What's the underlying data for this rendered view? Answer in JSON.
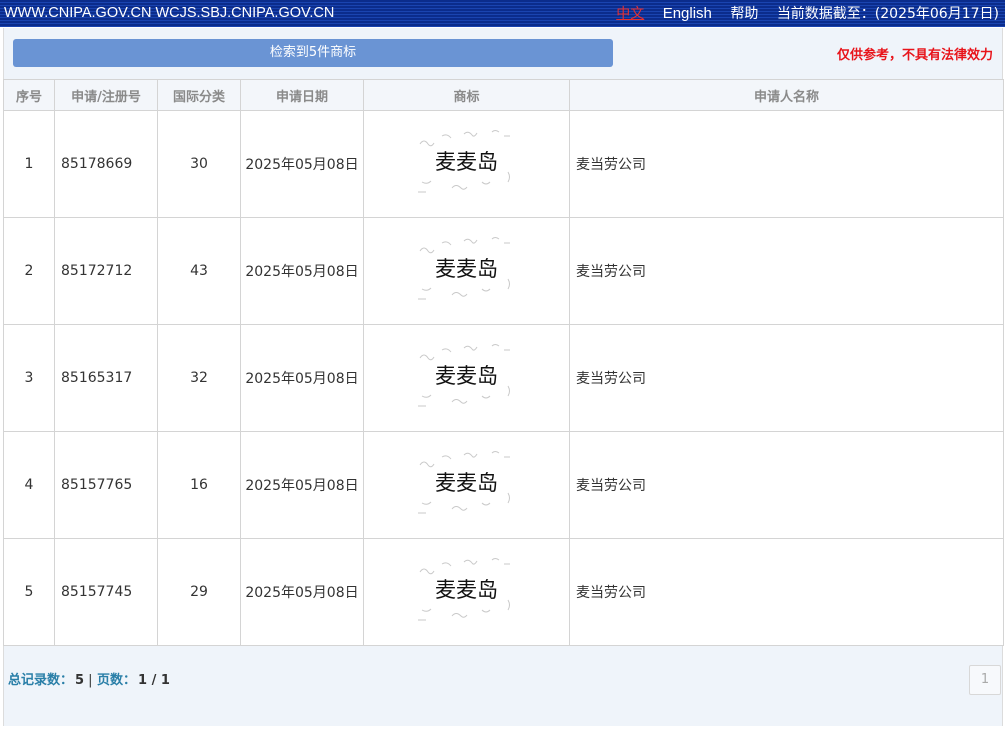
{
  "topbar": {
    "sites": "WWW.CNIPA.GOV.CN WCJS.SBJ.CNIPA.GOV.CN",
    "lang_cn": "中文",
    "lang_en": "English",
    "help": "帮助",
    "data_date": "当前数据截至：(2025年06月17日)"
  },
  "result": {
    "summary": "检索到5件商标",
    "disclaimer": "仅供参考，不具有法律效力"
  },
  "table": {
    "headers": [
      "序号",
      "申请/注册号",
      "国际分类",
      "申请日期",
      "商标",
      "申请人名称"
    ],
    "rows": [
      {
        "no": "1",
        "reg": "85178669",
        "class": "30",
        "date": "2025年05月08日",
        "mark": "麦麦岛",
        "applicant": "麦当劳公司"
      },
      {
        "no": "2",
        "reg": "85172712",
        "class": "43",
        "date": "2025年05月08日",
        "mark": "麦麦岛",
        "applicant": "麦当劳公司"
      },
      {
        "no": "3",
        "reg": "85165317",
        "class": "32",
        "date": "2025年05月08日",
        "mark": "麦麦岛",
        "applicant": "麦当劳公司"
      },
      {
        "no": "4",
        "reg": "85157765",
        "class": "16",
        "date": "2025年05月08日",
        "mark": "麦麦岛",
        "applicant": "麦当劳公司"
      },
      {
        "no": "5",
        "reg": "85157745",
        "class": "29",
        "date": "2025年05月08日",
        "mark": "麦麦岛",
        "applicant": "麦当劳公司"
      }
    ]
  },
  "footer": {
    "total_label": "总记录数：",
    "total_value": "5",
    "separator": "|",
    "pages_label": "页数：",
    "pages_value": "1 / 1",
    "pager_current": "1"
  },
  "colors": {
    "topbar": "#0b2c8c",
    "result_bar": "#6a94d4",
    "disclaimer": "#e8141b",
    "link": "#2a7fa8"
  }
}
